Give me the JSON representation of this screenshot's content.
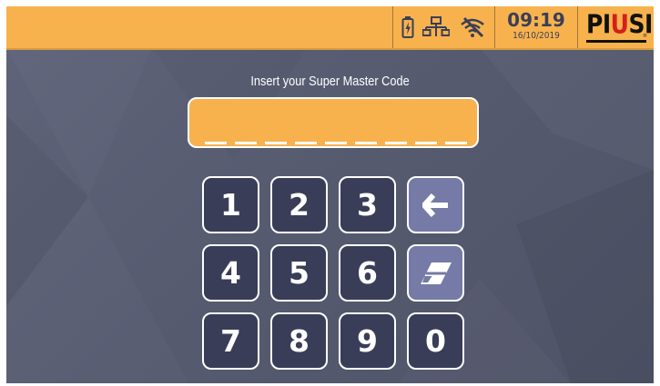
{
  "header": {
    "time": "09:19",
    "date": "16/10/2019",
    "logo": {
      "text": "PIUSI",
      "accent_letter": "U"
    },
    "status_icons": [
      "battery-charging-icon",
      "network-icon",
      "wifi-off-icon"
    ]
  },
  "prompt": "Insert your Super Master Code",
  "code_field": {
    "value": "",
    "length": 9
  },
  "keypad": {
    "rows": [
      [
        "1",
        "2",
        "3",
        "backspace"
      ],
      [
        "4",
        "5",
        "6",
        "clear"
      ],
      [
        "7",
        "8",
        "9",
        "0"
      ]
    ],
    "backspace_icon": "arrow-left-icon",
    "clear_icon": "eraser-icon"
  },
  "colors": {
    "accent": "#f7b24e",
    "key_background": "#3a3d58",
    "function_key_background": "#757aa6",
    "screen_background": "#5a5e74",
    "logo_accent": "#d41d1d"
  }
}
